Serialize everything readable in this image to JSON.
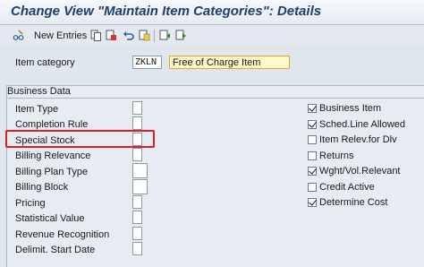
{
  "window": {
    "title": "Change View \"Maintain Item Categories\": Details"
  },
  "toolbar": {
    "new_entries_label": "New Entries",
    "icons": [
      "pencil-glasses-icon",
      "copy-icon",
      "delete-icon",
      "undo-icon",
      "copy-as-icon",
      "previous-entry-icon",
      "next-entry-icon"
    ]
  },
  "header": {
    "item_category_label": "Item category",
    "item_category_code": "ZKLN",
    "item_category_desc": "Free of Charge Item"
  },
  "business_data": {
    "title": "Business Data",
    "left_fields": [
      {
        "label": "Item Type",
        "value": ""
      },
      {
        "label": "Completion Rule",
        "value": ""
      },
      {
        "label": "Special Stock",
        "value": ""
      },
      {
        "label": "Billing Relevance",
        "value": ""
      },
      {
        "label": "Billing Plan Type",
        "value": ""
      },
      {
        "label": "Billing Block",
        "value": ""
      },
      {
        "label": "Pricing",
        "value": ""
      },
      {
        "label": "Statistical Value",
        "value": ""
      },
      {
        "label": "Revenue Recognition",
        "value": ""
      },
      {
        "label": "Delimit. Start Date",
        "value": ""
      }
    ],
    "right_checkboxes": [
      {
        "label": "Business Item",
        "checked": true
      },
      {
        "label": "Sched.Line Allowed",
        "checked": true
      },
      {
        "label": "Item Relev.for Dlv",
        "checked": false
      },
      {
        "label": "Returns",
        "checked": false
      },
      {
        "label": "Wght/Vol.Relevant",
        "checked": true
      },
      {
        "label": "Credit Active",
        "checked": false
      },
      {
        "label": "Determine Cost",
        "checked": true
      }
    ]
  },
  "colors": {
    "title": "#1c3f6d",
    "highlight": "#e02020",
    "desc_field_bg": "#fff7c6",
    "desc_field_border": "#e2a33a"
  }
}
